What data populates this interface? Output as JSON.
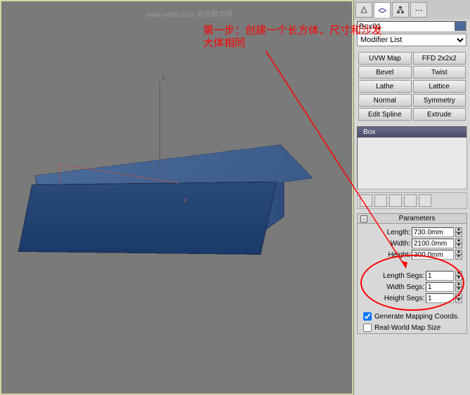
{
  "viewport": {
    "watermark": "www.webjx.com 网页教学网"
  },
  "annotation": {
    "line1": "第一步：创建一个长方体，尺寸和沙发",
    "line2": "大体相同"
  },
  "panel": {
    "object_name": "Box01",
    "modifier_dropdown": "Modifier List",
    "modifier_buttons": [
      "UVW Map",
      "FFD 2x2x2",
      "Bevel",
      "Twist",
      "Lathe",
      "Lattice",
      "Normal",
      "Symmetry",
      "Edit Spline",
      "Extrude"
    ],
    "stack_item": "Box",
    "rollout_title": "Parameters",
    "params": {
      "length_label": "Length:",
      "length_value": "730.0mm",
      "width_label": "Width:",
      "width_value": "2100.0mm",
      "height_label": "Height:",
      "height_value": "300.0mm",
      "lsegs_label": "Length Segs:",
      "lsegs_value": "1",
      "wsegs_label": "Width Segs:",
      "wsegs_value": "1",
      "hsegs_label": "Height Segs:",
      "hsegs_value": "1"
    },
    "checkboxes": {
      "gen_mapping": "Generate Mapping Coords.",
      "realworld": "Real-World Map Size"
    }
  }
}
